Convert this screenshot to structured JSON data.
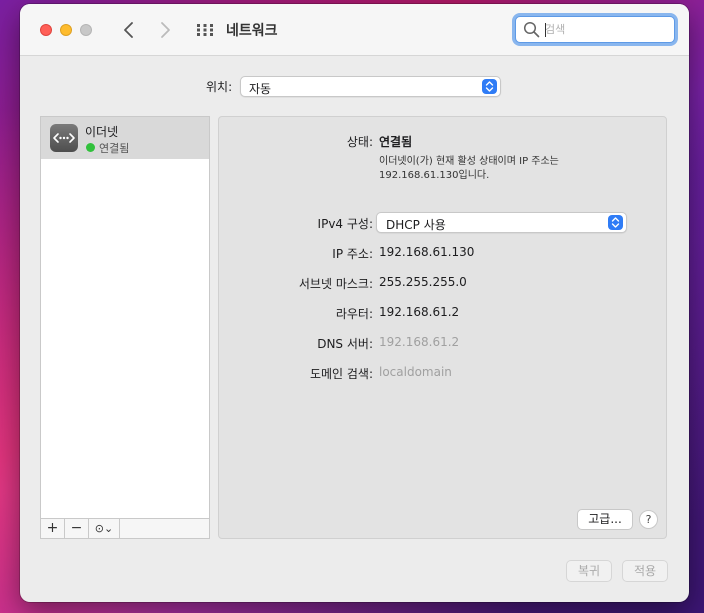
{
  "window": {
    "title": "네트워크"
  },
  "search": {
    "placeholder": "검색"
  },
  "location": {
    "label": "위치:",
    "value": "자동"
  },
  "sidebar": {
    "services": [
      {
        "name": "이더넷",
        "status": "연결됨",
        "icon": "ethernet-icon"
      }
    ],
    "add_label": "+",
    "remove_label": "−",
    "action_label": "⊙⌄"
  },
  "detail": {
    "status_label": "상태:",
    "status_value": "연결됨",
    "status_description": "이더넷이(가) 현재 활성 상태이며 IP 주소는 192.168.61.130입니다.",
    "ipv4_label": "IPv4 구성:",
    "ipv4_value": "DHCP 사용",
    "ip_label": "IP 주소:",
    "ip_value": "192.168.61.130",
    "subnet_label": "서브넷 마스크:",
    "subnet_value": "255.255.255.0",
    "router_label": "라우터:",
    "router_value": "192.168.61.2",
    "dns_label": "DNS 서버:",
    "dns_value": "192.168.61.2",
    "domain_label": "도메인 검색:",
    "domain_value": "localdomain",
    "advanced_label": "고급...",
    "help_label": "?"
  },
  "footer": {
    "revert_label": "복귀",
    "apply_label": "적용"
  },
  "colors": {
    "accent": "#2f7cf6",
    "connected": "#31c13c"
  }
}
